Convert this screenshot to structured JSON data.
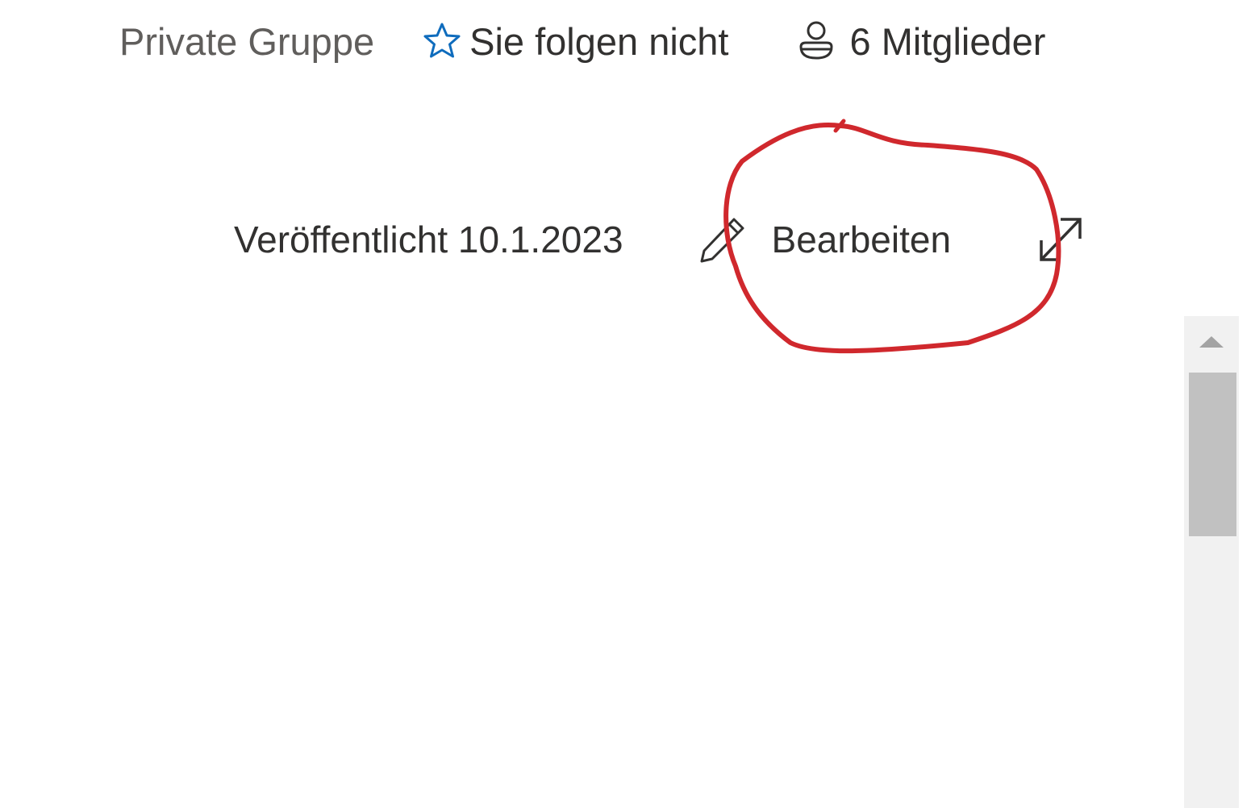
{
  "group_header": {
    "privacy_label": "Private Gruppe",
    "follow_label": "Sie folgen nicht",
    "follow_icon": "star-outline-icon",
    "members_label": "6 Mitglieder",
    "members_icon": "person-icon"
  },
  "page_meta": {
    "published_label": "Veröffentlicht 10.1.2023",
    "edit_label": "Bearbeiten",
    "edit_icon": "pencil-icon",
    "expand_icon": "expand-diagonal-icon"
  },
  "annotation": {
    "shape": "hand-drawn-circle",
    "color": "#d0282d"
  },
  "scrollbar": {
    "up_icon": "triangle-up-icon"
  },
  "colors": {
    "accent": "#0f6cbd",
    "text": "#323130",
    "muted_text": "#605e5c",
    "annotation": "#d0282d"
  }
}
